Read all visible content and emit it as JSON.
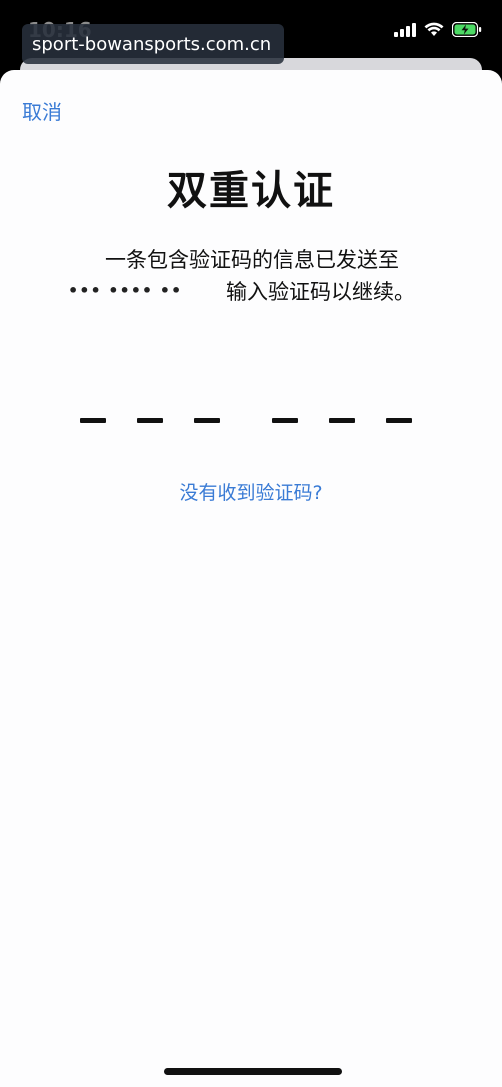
{
  "status_bar": {
    "time": "10:16",
    "url": "sport-bowansports.com.cn",
    "icons": [
      "location-arrow-icon",
      "cellular-signal-icon",
      "wifi-icon",
      "battery-charging-icon"
    ]
  },
  "nav": {
    "cancel_label": "取消"
  },
  "main": {
    "title": "双重认证",
    "message_line1": "一条包含验证码的信息已发送至",
    "masked_phone": "••• •••• ••",
    "message_suffix": "输入验证码以继续。",
    "code_slots": 6,
    "resend_label": "没有收到验证码?"
  },
  "colors": {
    "accent": "#3a7bd5",
    "text": "#111111",
    "background": "#fdfdfe",
    "battery": "#4cd964"
  }
}
